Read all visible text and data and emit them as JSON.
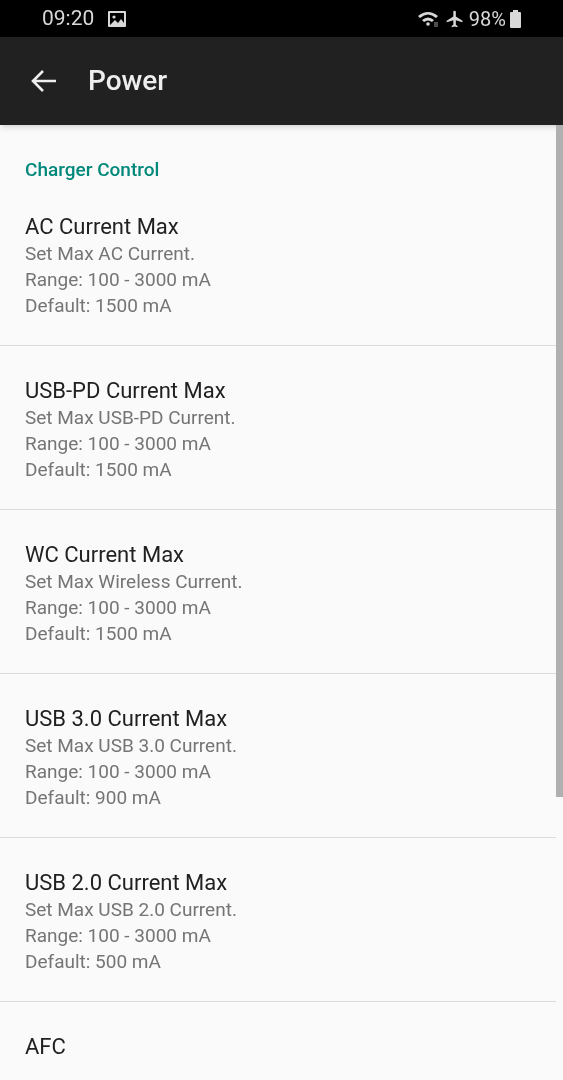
{
  "status_bar": {
    "time": "09:20",
    "battery": "98%"
  },
  "app_bar": {
    "title": "Power"
  },
  "section": {
    "title": "Charger Control"
  },
  "items": [
    {
      "title": "AC Current Max",
      "lines": [
        "Set Max AC Current.",
        "Range: 100 - 3000 mA",
        "Default: 1500 mA"
      ]
    },
    {
      "title": "USB-PD Current Max",
      "lines": [
        "Set Max USB-PD Current.",
        "Range: 100 - 3000 mA",
        "Default: 1500 mA"
      ]
    },
    {
      "title": "WC Current Max",
      "lines": [
        "Set Max Wireless Current.",
        "Range: 100 - 3000 mA",
        "Default: 1500 mA"
      ]
    },
    {
      "title": "USB 3.0 Current Max",
      "lines": [
        "Set Max USB 3.0 Current.",
        "Range: 100 - 3000 mA",
        "Default: 900 mA"
      ]
    },
    {
      "title": "USB 2.0 Current Max",
      "lines": [
        "Set Max USB 2.0 Current.",
        "Range: 100 - 3000 mA",
        "Default: 500 mA"
      ]
    },
    {
      "title": "AFC"
    }
  ]
}
